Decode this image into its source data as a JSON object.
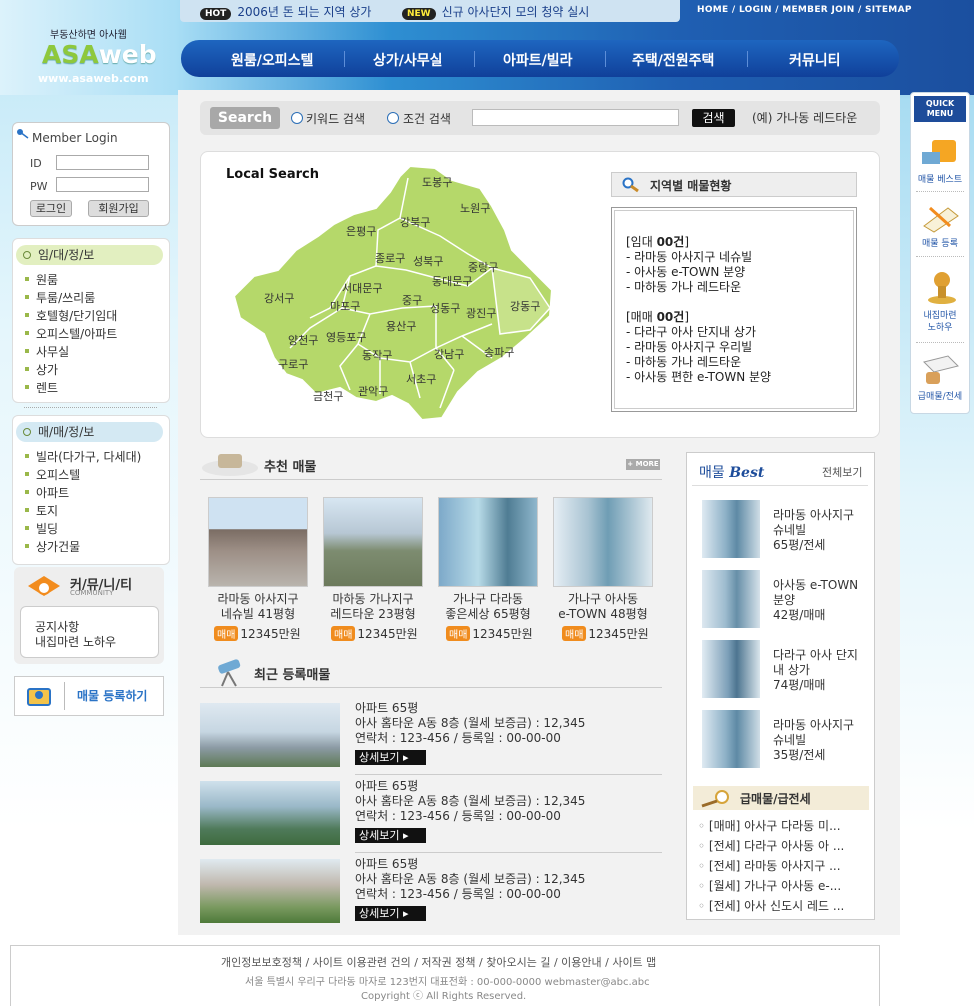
{
  "ticker": {
    "hot_tag": "HOT",
    "hot_text": "2006년 돈 되는 지역 상가",
    "new_tag": "NEW",
    "new_text": "신규 아사단지 모의 청약 실시"
  },
  "top_links": "HOME / LOGIN / MEMBER JOIN / SITEMAP",
  "logo": {
    "sub": "부동산하면 아사웹",
    "name_a": "ASA",
    "name_b": "web",
    "url": "www.asaweb.com"
  },
  "nav": [
    "원룸/오피스텔",
    "상가/사무실",
    "아파트/빌라",
    "주택/전원주택",
    "커뮤니티"
  ],
  "search": {
    "badge": "Search",
    "opt1": "키워드 검색",
    "opt2": "조건 검색",
    "button": "검색",
    "example": "(예) 가나동 레드타운"
  },
  "local": {
    "title": "Local Search",
    "districts": [
      "도봉구",
      "노원구",
      "강북구",
      "은평구",
      "종로구",
      "성북구",
      "중랑구",
      "동대문구",
      "서대문구",
      "강서구",
      "마포구",
      "중구",
      "성동구",
      "광진구",
      "강동구",
      "용산구",
      "양천구",
      "영등포구",
      "동작구",
      "강남구",
      "송파구",
      "구로구",
      "관악구",
      "서초구",
      "금천구"
    ],
    "status_title": "지역별 매물현황",
    "rent_head_a": "[임대 ",
    "rent_head_b": "00건",
    "rent_head_c": "]",
    "rent": [
      "- 라마동 아사지구 네슈빌",
      "- 아사동 e-TOWN 분양",
      "- 마하동 가나 레드타운"
    ],
    "sale_head_a": "[매매 ",
    "sale_head_b": "00건",
    "sale_head_c": "]",
    "sale": [
      "- 다라구 아사 단지내 상가",
      "- 라마동 아사지구 우리빌",
      "- 마하동 가나 레드타운",
      "- 아사동 편한 e-TOWN 분양"
    ]
  },
  "recommended": {
    "title": "추천 매물",
    "more": "+ MORE",
    "items": [
      {
        "line1": "라마동 아사지구",
        "line2": "네슈빌 41평형",
        "badge": "매매",
        "price": "12345만원"
      },
      {
        "line1": "마하동 가나지구",
        "line2": "레드타운 23평형",
        "badge": "매매",
        "price": "12345만원"
      },
      {
        "line1": "가나구 다라동",
        "line2": "좋은세상 65평형",
        "badge": "매매",
        "price": "12345만원"
      },
      {
        "line1": "가나구 아사동",
        "line2": "e-TOWN 48평형",
        "badge": "매매",
        "price": "12345만원"
      }
    ]
  },
  "recent": {
    "title": "최근 등록매물",
    "items": [
      {
        "type": "아파트 65평",
        "desc": "아사 홈타운 A동 8층 (월세 보증금) : 12,345",
        "contact": "연락처 : 123-456 / 등록일 : 00-00-00",
        "button": "상세보기"
      },
      {
        "type": "아파트 65평",
        "desc": "아사 홈타운 A동 8층 (월세 보증금) : 12,345",
        "contact": "연락처 : 123-456 / 등록일 : 00-00-00",
        "button": "상세보기"
      },
      {
        "type": "아파트 65평",
        "desc": "아사 홈타운 A동 8층 (월세 보증금) : 12,345",
        "contact": "연락처 : 123-456 / 등록일 : 00-00-00",
        "button": "상세보기"
      }
    ]
  },
  "best": {
    "title_a": "매물 ",
    "title_b": "Best",
    "all": "전체보기",
    "items": [
      {
        "l1": "라마동 아사지구",
        "l2": "슈네빌",
        "l3": "65평/전세"
      },
      {
        "l1": "아사동 e-TOWN",
        "l2": "분양",
        "l3": "42평/매매"
      },
      {
        "l1": "다라구 아사 단지",
        "l2": "내 상가",
        "l3": "74평/매매"
      },
      {
        "l1": "라마동 아사지구",
        "l2": "슈네빌",
        "l3": "35평/전세"
      }
    ]
  },
  "urgent": {
    "title": "급매물/급전세",
    "items": [
      "[매매] 아사구 다라동 미...",
      "[전세] 다라구 아사동 아 ...",
      "[전세] 라마동 아사지구 ...",
      "[월세] 가나구 아사동 e-...",
      "[전세] 아사 신도시 레드 ..."
    ]
  },
  "login": {
    "title": "Member Login",
    "id": "ID",
    "pw": "PW",
    "login_btn": "로그인",
    "join_btn": "회원가입"
  },
  "menu1": {
    "head": "임/대/정/보",
    "items": [
      "원룸",
      "투룸/쓰리룸",
      "호텔형/단기임대",
      "오피스텔/아파트",
      "사무실",
      "상가",
      "렌트"
    ]
  },
  "menu2": {
    "head": "매/매/정/보",
    "items": [
      "빌라(다가구, 다세대)",
      "오피스텔",
      "아파트",
      "토지",
      "빌딩",
      "상가건물"
    ]
  },
  "community": {
    "title": "커/뮤/니/티",
    "sub": "COMMUNITY",
    "items": [
      "공지사항",
      "내집마련 노하우"
    ]
  },
  "register_banner": "매물 등록하기",
  "quick": {
    "head1": "QUICK",
    "head2": "MENU",
    "items": [
      {
        "l1": "매물 베스트",
        "l2": ""
      },
      {
        "l1": "매물 등록",
        "l2": ""
      },
      {
        "l1": "내집마련",
        "l2": "노하우"
      },
      {
        "l1": "급매물/전세",
        "l2": ""
      }
    ]
  },
  "footer": {
    "links": "개인정보보호정책  /  사이트 이용관련 건의  /  저작권 정책  /  찾아오시는 길  /  이용안내  /  사이트 맵",
    "address": "서울 특별시 우리구 다라동 마자로 123번지    대표전화 : 00-000-0000    webmaster@abc.abc",
    "copyright": "Copyright ⓒ All Rights Reserved."
  }
}
